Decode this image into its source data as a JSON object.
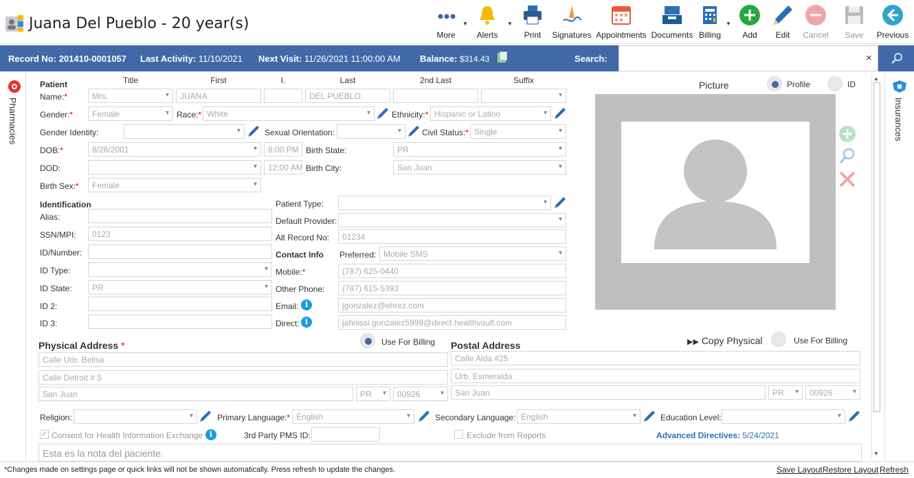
{
  "header": {
    "title": "Juana Del Pueblo - 20 year(s)"
  },
  "toolbar": [
    {
      "label": "More",
      "icon": "more-dots-icon"
    },
    {
      "label": "Alerts",
      "icon": "bell-icon"
    },
    {
      "label": "Print",
      "icon": "printer-icon"
    },
    {
      "label": "Signatures",
      "icon": "pen-signature-icon"
    },
    {
      "label": "Appointments",
      "icon": "calendar-icon"
    },
    {
      "label": "Documents",
      "icon": "inbox-tray-icon"
    },
    {
      "label": "Billing",
      "icon": "billing-icon"
    },
    {
      "label": "Add",
      "icon": "plus-circle-icon"
    },
    {
      "label": "Edit",
      "icon": "pencil-icon"
    },
    {
      "label": "Cancel",
      "icon": "minus-circle-icon"
    },
    {
      "label": "Save",
      "icon": "floppy-icon"
    },
    {
      "label": "Previous",
      "icon": "arrow-left-circle-icon"
    }
  ],
  "info": {
    "record_label": "Record No:",
    "record": "201410-0001057",
    "activity_label": "Last Activity:",
    "activity": "11/10/2021",
    "visit_label": "Next Visit:",
    "visit": "11/26/2021 11:00:00 AM",
    "balance_label": "Balance:",
    "balance": "$314.43",
    "search_label": "Search:",
    "close": "×"
  },
  "sidebars": {
    "left": "Pharmacies",
    "right": "Insurances"
  },
  "patient": {
    "section": "Patient",
    "col_title": "Title",
    "col_first": "First",
    "col_i": "I.",
    "col_last": "Last",
    "col_2nd": "2nd Last",
    "col_suffix": "Suffix",
    "name_label": "Name:",
    "title": "Mrs.",
    "first": "JUANA",
    "last": "DEL PUEBLO",
    "gender_label": "Gender:",
    "gender": "Female",
    "race_label": "Race:",
    "race": "White",
    "ethnicity_label": "Ethnicity:",
    "ethnicity": "Hispanic or Latino",
    "gender_identity_label": "Gender Identity:",
    "sexual_orientation_label": "Sexual Orientation:",
    "civil_label": "Civil Status:",
    "civil": "Single",
    "dob_label": "DOB:",
    "dob": "8/28/2001",
    "dob_time": "8:00 PM",
    "birth_state_label": "Birth State:",
    "birth_state": "PR",
    "dod_label": "DOD:",
    "dod_time": "12:00 AM",
    "birth_city_label": "Birth City:",
    "birth_city": "San Juan",
    "birth_sex_label": "Birth Sex:",
    "birth_sex": "Female"
  },
  "identification": {
    "section": "Identification",
    "alias_label": "Alias:",
    "ssn_label": "SSN/MPI:",
    "ssn": "0123",
    "idnum_label": "ID/Number:",
    "idtype_label": "ID Type:",
    "idstate_label": "ID State:",
    "idstate": "PR",
    "id2_label": "ID 2:",
    "id3_label": "ID 3:",
    "ptype_label": "Patient Type:",
    "provider_label": "Default Provider:",
    "alt_label": "Alt Record No:",
    "alt": "01234"
  },
  "contact": {
    "section": "Contact Info",
    "pref_label": "Preferred:",
    "pref": "Mobile SMS",
    "mobile_label": "Mobile:",
    "mobile": "(787) 625-0440",
    "other_label": "Other Phone:",
    "other": "(787) 615-5393",
    "email_label": "Email:",
    "email": "jgonzalez@ehrez.com",
    "direct_label": "Direct:",
    "direct": "jahnissi.gonzalez5999@direct.healthvault.com"
  },
  "picture": {
    "label": "Picture",
    "profile": "Profile",
    "id": "ID"
  },
  "physical": {
    "section": "Physical Address",
    "use_billing": "Use For Billing",
    "line1": "Calle Urb. Belisa",
    "line2": "Calle Detroit # 5",
    "city": "San Juan",
    "state": "PR",
    "zip": "00926"
  },
  "postal": {
    "section": "Postal Address",
    "copy": "Copy Physical",
    "use_billing": "Use For Billing",
    "line1": "Calle Alda #25",
    "line2": "Urb. Esmeralda",
    "city": "San Juan",
    "state": "PR",
    "zip": "00926"
  },
  "bottom": {
    "religion_label": "Religion:",
    "primary_label": "Primary Language:",
    "primary": "English",
    "secondary_label": "Secondary Language:",
    "secondary": "English",
    "education_label": "Education Level:",
    "consent": "Consent for Health Information Exchange",
    "pms_label": "3rd Party PMS ID:",
    "exclude": "Exclude from Reports",
    "adv_label": "Advanced Directives:",
    "adv": "5/24/2021",
    "note": "Esta es la nota del paciente."
  },
  "footer": {
    "message": "*Changes made on settings page or quick links will not be shown automatically. Press refresh to update the changes.",
    "save_layout": "Save Layout",
    "restore_layout": "Restore Layout",
    "refresh": "Refresh"
  },
  "colors": {
    "accent": "#4169a7",
    "required": "#dd0000",
    "info": "#1e9be0"
  }
}
